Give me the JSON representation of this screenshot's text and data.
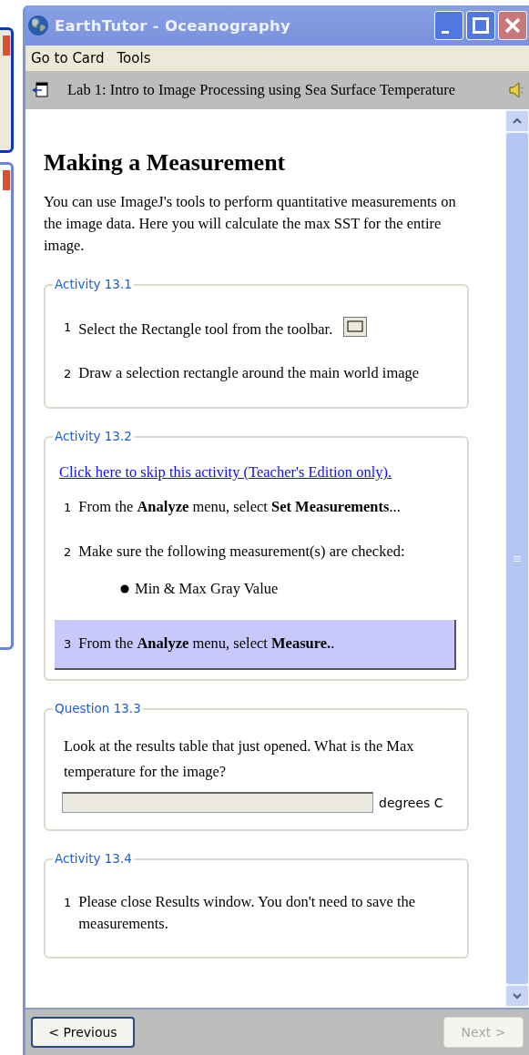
{
  "window": {
    "title": "EarthTutor - Oceanography"
  },
  "menu": [
    "Go to Card",
    "Tools"
  ],
  "lab_bar": {
    "title": "Lab 1: Intro to Image Processing using Sea Surface Temperature"
  },
  "page": {
    "heading": "Making a Measurement",
    "intro": "You can use ImageJ's tools to perform quantitative measurements on the image data. Here you will calculate the max SST for the entire image."
  },
  "sections": [
    {
      "legend": "Activity 13.1",
      "items": [
        {
          "kind": "tool-step",
          "number": "1",
          "text": "Select the Rectangle tool from the toolbar."
        },
        {
          "kind": "step",
          "number": "2",
          "text": "Draw a selection rectangle around the main world image"
        }
      ]
    },
    {
      "legend": "Activity 13.2",
      "items": [
        {
          "kind": "link",
          "text": "Click here to skip this activity (Teacher's Edition only)."
        },
        {
          "kind": "step",
          "number": "1",
          "text": "From the **Analyze** menu, select **Set Measurements**..."
        },
        {
          "kind": "step",
          "number": "2",
          "text": "Make sure the following measurement(s) are checked:"
        },
        {
          "kind": "bullet",
          "text": "Min & Max Gray Value"
        },
        {
          "kind": "current-step",
          "number": "3",
          "text": "From the **Analyze** menu, select **Measure.**."
        }
      ]
    },
    {
      "legend": "Question 13.3",
      "items": [
        {
          "kind": "prompt",
          "text": "Look at the results table that just opened. What is the Max temperature for the image?"
        },
        {
          "kind": "answer",
          "unit": "degrees C"
        }
      ]
    },
    {
      "legend": "Activity 13.4",
      "items": [
        {
          "kind": "step",
          "number": "1",
          "text": "Please close Results window. You don't need to save the measurements."
        }
      ]
    }
  ],
  "buttons": [
    {
      "label": "< Previous",
      "disabled": false
    },
    {
      "label": "Next >",
      "disabled": true
    }
  ]
}
